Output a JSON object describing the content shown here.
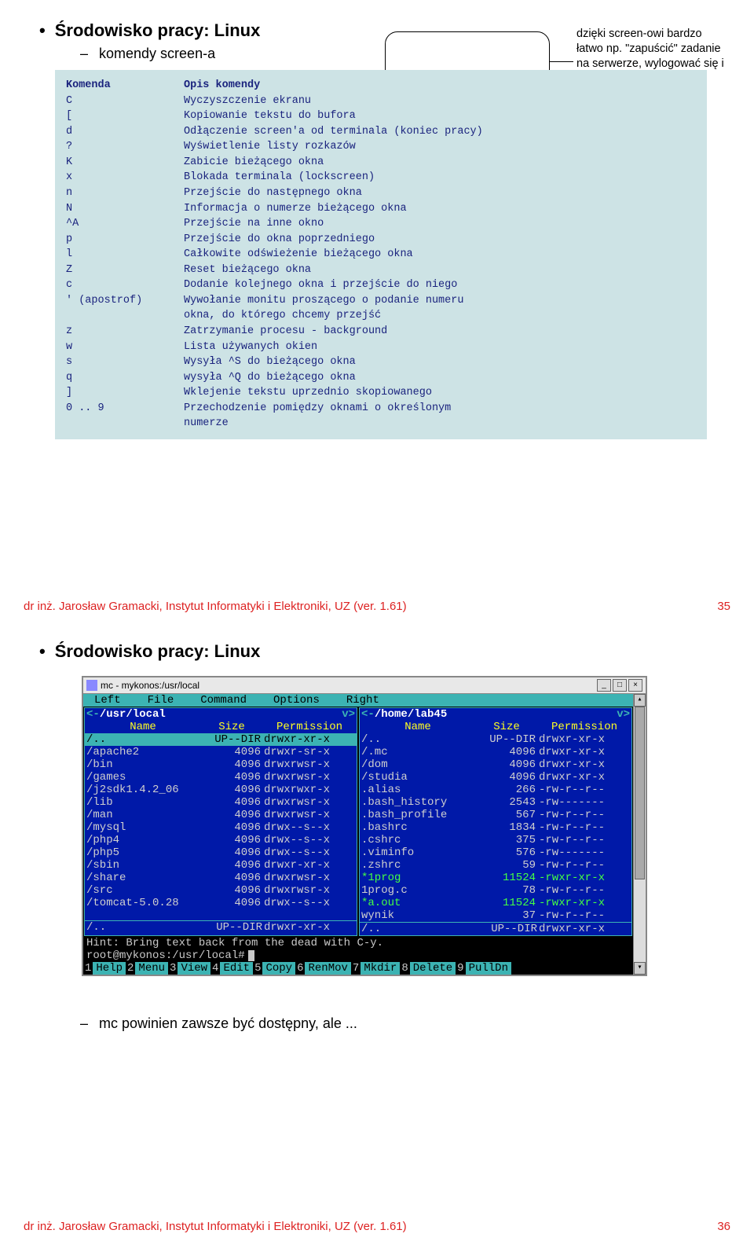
{
  "slide1": {
    "title": "Środowisko pracy: Linux",
    "subtitle": "komendy screen-a",
    "note": "dzięki screen-owi bardzo łatwo np. \"zapuścić\" zadanie na serwerze, wylogować się i wrócić do niego na drugi dzień",
    "table": {
      "header_key": "Komenda",
      "header_desc": "Opis komendy",
      "rows": [
        {
          "k": "C",
          "d": "Wyczyszczenie ekranu"
        },
        {
          "k": "[",
          "d": "Kopiowanie tekstu do bufora"
        },
        {
          "k": "d",
          "d": "Odłączenie screen'a od terminala (koniec pracy)"
        },
        {
          "k": "?",
          "d": "Wyświetlenie listy rozkazów"
        },
        {
          "k": "K",
          "d": "Zabicie bieżącego okna"
        },
        {
          "k": "x",
          "d": "Blokada terminala (lockscreen)"
        },
        {
          "k": "n",
          "d": "Przejście do następnego okna"
        },
        {
          "k": "N",
          "d": "Informacja o numerze bieżącego okna"
        },
        {
          "k": "^A",
          "d": "Przejście na inne okno"
        },
        {
          "k": "p",
          "d": "Przejście do okna poprzedniego"
        },
        {
          "k": "l",
          "d": "Całkowite odświeżenie bieżącego okna"
        },
        {
          "k": "Z",
          "d": "Reset bieżącego okna"
        },
        {
          "k": "c",
          "d": "Dodanie kolejnego okna i przejście do niego"
        },
        {
          "k": "' (apostrof)",
          "d": "Wywołanie monitu proszącego o podanie numeru"
        },
        {
          "k": "",
          "d": "okna, do którego chcemy przejść"
        },
        {
          "k": "z",
          "d": "Zatrzymanie procesu - background"
        },
        {
          "k": "w",
          "d": "Lista używanych okien"
        },
        {
          "k": "s",
          "d": "Wysyła ^S do bieżącego okna"
        },
        {
          "k": "q",
          "d": "wysyła ^Q do bieżącego okna"
        },
        {
          "k": "]",
          "d": "Wklejenie tekstu uprzednio skopiowanego"
        },
        {
          "k": "0 .. 9",
          "d": "Przechodzenie pomiędzy oknami o określonym"
        },
        {
          "k": "",
          "d": "numerze"
        }
      ]
    },
    "footer_text": "dr inż. Jarosław Gramacki, Instytut Informatyki i Elektroniki, UZ (ver. 1.61)",
    "footer_page": "35"
  },
  "slide2": {
    "title": "Środowisko pracy: Linux",
    "mc": {
      "titlebar": "mc - mykonos:/usr/local",
      "menu": [
        "Left",
        "File",
        "Command",
        "Options",
        "Right"
      ],
      "left_path": "/usr/local",
      "right_path": "/home/lab45",
      "headers": {
        "name": "Name",
        "size": "Size",
        "perm": "Permission"
      },
      "left_rows": [
        {
          "n": "/..",
          "s": "UP--DIR",
          "p": "drwxr-xr-x",
          "sel": true
        },
        {
          "n": "/apache2",
          "s": "4096",
          "p": "drwxr-sr-x"
        },
        {
          "n": "/bin",
          "s": "4096",
          "p": "drwxrwsr-x"
        },
        {
          "n": "/games",
          "s": "4096",
          "p": "drwxrwsr-x"
        },
        {
          "n": "/j2sdk1.4.2_06",
          "s": "4096",
          "p": "drwxrwxr-x"
        },
        {
          "n": "/lib",
          "s": "4096",
          "p": "drwxrwsr-x"
        },
        {
          "n": "/man",
          "s": "4096",
          "p": "drwxrwsr-x"
        },
        {
          "n": "/mysql",
          "s": "4096",
          "p": "drwx--s--x"
        },
        {
          "n": "/php4",
          "s": "4096",
          "p": "drwx--s--x"
        },
        {
          "n": "/php5",
          "s": "4096",
          "p": "drwx--s--x"
        },
        {
          "n": "/sbin",
          "s": "4096",
          "p": "drwxr-xr-x"
        },
        {
          "n": "/share",
          "s": "4096",
          "p": "drwxrwsr-x"
        },
        {
          "n": "/src",
          "s": "4096",
          "p": "drwxrwsr-x"
        },
        {
          "n": "/tomcat-5.0.28",
          "s": "4096",
          "p": "drwx--s--x"
        }
      ],
      "left_foot": {
        "n": "/..",
        "s": "UP--DIR",
        "p": "drwxr-xr-x"
      },
      "right_rows": [
        {
          "n": "/..",
          "s": "UP--DIR",
          "p": "drwxr-xr-x"
        },
        {
          "n": "/.mc",
          "s": "4096",
          "p": "drwxr-xr-x"
        },
        {
          "n": "/dom",
          "s": "4096",
          "p": "drwxr-xr-x"
        },
        {
          "n": "/studia",
          "s": "4096",
          "p": "drwxr-xr-x"
        },
        {
          "n": " .alias",
          "s": "266",
          "p": "-rw-r--r--"
        },
        {
          "n": " .bash_history",
          "s": "2543",
          "p": "-rw-------"
        },
        {
          "n": " .bash_profile",
          "s": "567",
          "p": "-rw-r--r--"
        },
        {
          "n": " .bashrc",
          "s": "1834",
          "p": "-rw-r--r--"
        },
        {
          "n": " .cshrc",
          "s": "375",
          "p": "-rw-r--r--"
        },
        {
          "n": " .viminfo",
          "s": "576",
          "p": "-rw-------"
        },
        {
          "n": " .zshrc",
          "s": "59",
          "p": "-rw-r--r--"
        },
        {
          "n": "*1prog",
          "s": "11524",
          "p": "-rwxr-xr-x",
          "exec": true
        },
        {
          "n": " 1prog.c",
          "s": "78",
          "p": "-rw-r--r--"
        },
        {
          "n": "*a.out",
          "s": "11524",
          "p": "-rwxr-xr-x",
          "exec": true
        },
        {
          "n": " wynik",
          "s": "37",
          "p": "-rw-r--r--"
        }
      ],
      "right_foot": {
        "n": "/..",
        "s": "UP--DIR",
        "p": "drwxr-xr-x"
      },
      "hint": "Hint: Bring text back from the dead with C-y.",
      "prompt": "root@mykonos:/usr/local#",
      "fkeys": [
        {
          "n": "1",
          "l": "Help"
        },
        {
          "n": "2",
          "l": "Menu"
        },
        {
          "n": "3",
          "l": "View"
        },
        {
          "n": "4",
          "l": "Edit"
        },
        {
          "n": "5",
          "l": "Copy"
        },
        {
          "n": "6",
          "l": "RenMov"
        },
        {
          "n": "7",
          "l": "Mkdir"
        },
        {
          "n": "8",
          "l": "Delete"
        },
        {
          "n": "9",
          "l": "PullDn"
        }
      ]
    },
    "bottom_note": "mc powinien zawsze być dostępny, ale ...",
    "footer_text": "dr inż. Jarosław Gramacki, Instytut Informatyki i Elektroniki, UZ (ver. 1.61)",
    "footer_page": "36"
  }
}
